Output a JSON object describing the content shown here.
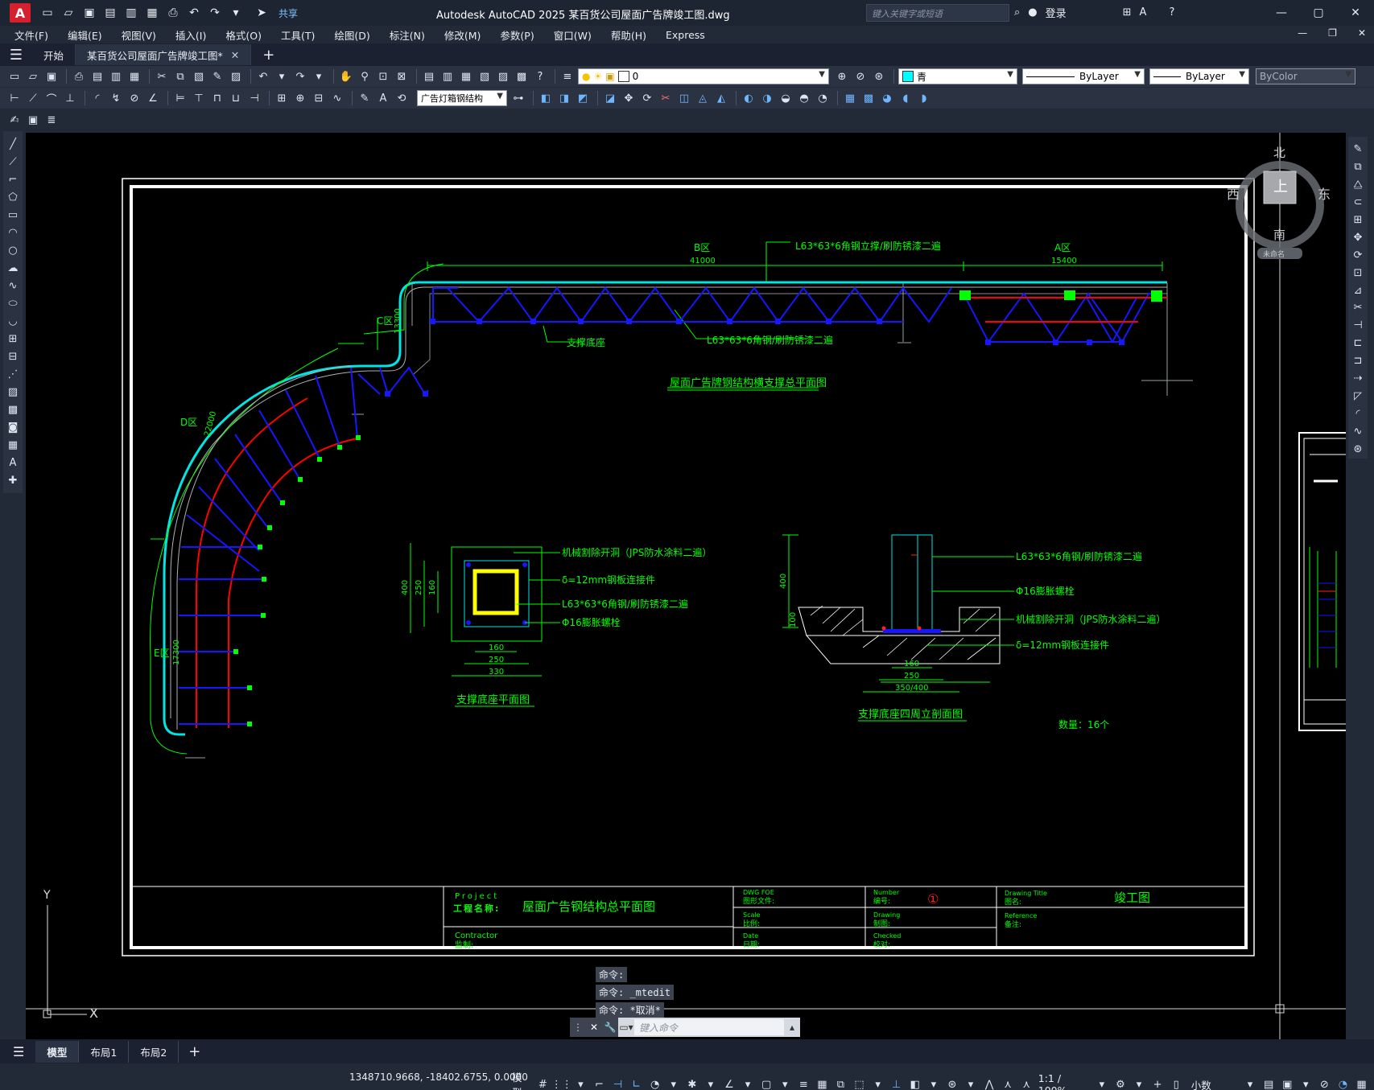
{
  "titlebar": {
    "app_logo": "A",
    "share_label": "共享",
    "title": "Autodesk AutoCAD 2025    某百货公司屋面广告牌竣工图.dwg",
    "search_placeholder": "键入关键字或短语",
    "login_label": "登录"
  },
  "menu": [
    "文件(F)",
    "编辑(E)",
    "视图(V)",
    "插入(I)",
    "格式(O)",
    "工具(T)",
    "绘图(D)",
    "标注(N)",
    "修改(M)",
    "参数(P)",
    "窗口(W)",
    "帮助(H)",
    "Express"
  ],
  "tabs": {
    "start": "开始",
    "document": "某百货公司屋面广告牌竣工图*"
  },
  "properties": {
    "layer_value": "0",
    "color_value": "青",
    "color_hex": "#00ffff",
    "linetype_value": "ByLayer",
    "lineweight_value": "ByLayer",
    "plotstyle_value": "ByColor",
    "textstyle_value": "广告灯箱钢结构"
  },
  "viewcube": {
    "north": "北",
    "south": "南",
    "east": "东",
    "west": "西",
    "top": "上",
    "wcs": "未命名"
  },
  "drawing": {
    "zone_b": "B区",
    "dim_b": "41000",
    "zone_a": "A区",
    "dim_a": "15400",
    "zone_c": "C区",
    "dim_c": "13300",
    "zone_d": "D区",
    "dim_d": "22000",
    "zone_e": "E区",
    "dim_e": "17300",
    "note_top": "L63*63*6角钢立撑/刷防锈漆二遍",
    "note_support": "支撑底座",
    "note_steel": "L63*63*6角钢/刷防锈漆二遍",
    "plan_title": "屋面广告牌钢结构横支撑总平面图",
    "base_notes": [
      "机械割除开洞（JPS防水涂料二遍）",
      "δ=12mm钢板连接件",
      "L63*63*6角钢/刷防锈漆二遍",
      "Φ16膨胀螺栓"
    ],
    "base_dims_v": [
      "400",
      "250",
      "160"
    ],
    "base_dims_h": [
      "160",
      "250",
      "330"
    ],
    "base_title": "支撑底座平面图",
    "sec_notes": [
      "L63*63*6角钢/刷防锈漆二遍",
      "Φ16膨胀螺栓",
      "机械割除开洞（JPS防水涂料二遍）",
      "δ=12mm钢板连接件"
    ],
    "sec_dims_v": [
      "400",
      "100"
    ],
    "sec_dims_h": [
      "160",
      "250",
      "350/400"
    ],
    "sec_title": "支撑底座四周立剖面图",
    "quantity": "数量：16个"
  },
  "titleblock": {
    "project_en": "Project",
    "project_cn": "工程名称:",
    "project_name": "屋面广告钢结构总平面图",
    "contractor_en": "Contractor",
    "contractor_cn": "监制:",
    "dwg_file_en": "DWG FOE",
    "dwg_file_cn": "图形文件:",
    "scale_en": "Scale",
    "scale_cn": "比例:",
    "date_en": "Date",
    "date_cn": "日期:",
    "number_en": "Number",
    "number_cn": "编号:",
    "number_value": "①",
    "drawing_en": "Drawing",
    "drawing_cn": "制图:",
    "checked_en": "Checked",
    "checked_cn": "校对:",
    "title_en": "Drawing Title",
    "title_cn": "图名:",
    "title_value": "竣工图",
    "ref_en": "Reference",
    "ref_cn": "备注:"
  },
  "ucs": {
    "y": "Y",
    "x": "X"
  },
  "command": {
    "history": [
      "命令:",
      "命令: _mtedit",
      "命令: *取消*"
    ],
    "placeholder": "键入命令"
  },
  "layout_tabs": [
    "模型",
    "布局1",
    "布局2"
  ],
  "status": {
    "coords": "1348710.9668, -18402.6755, 0.0000",
    "model": "模型",
    "scale": "1:1 / 100%",
    "units": "小数"
  }
}
